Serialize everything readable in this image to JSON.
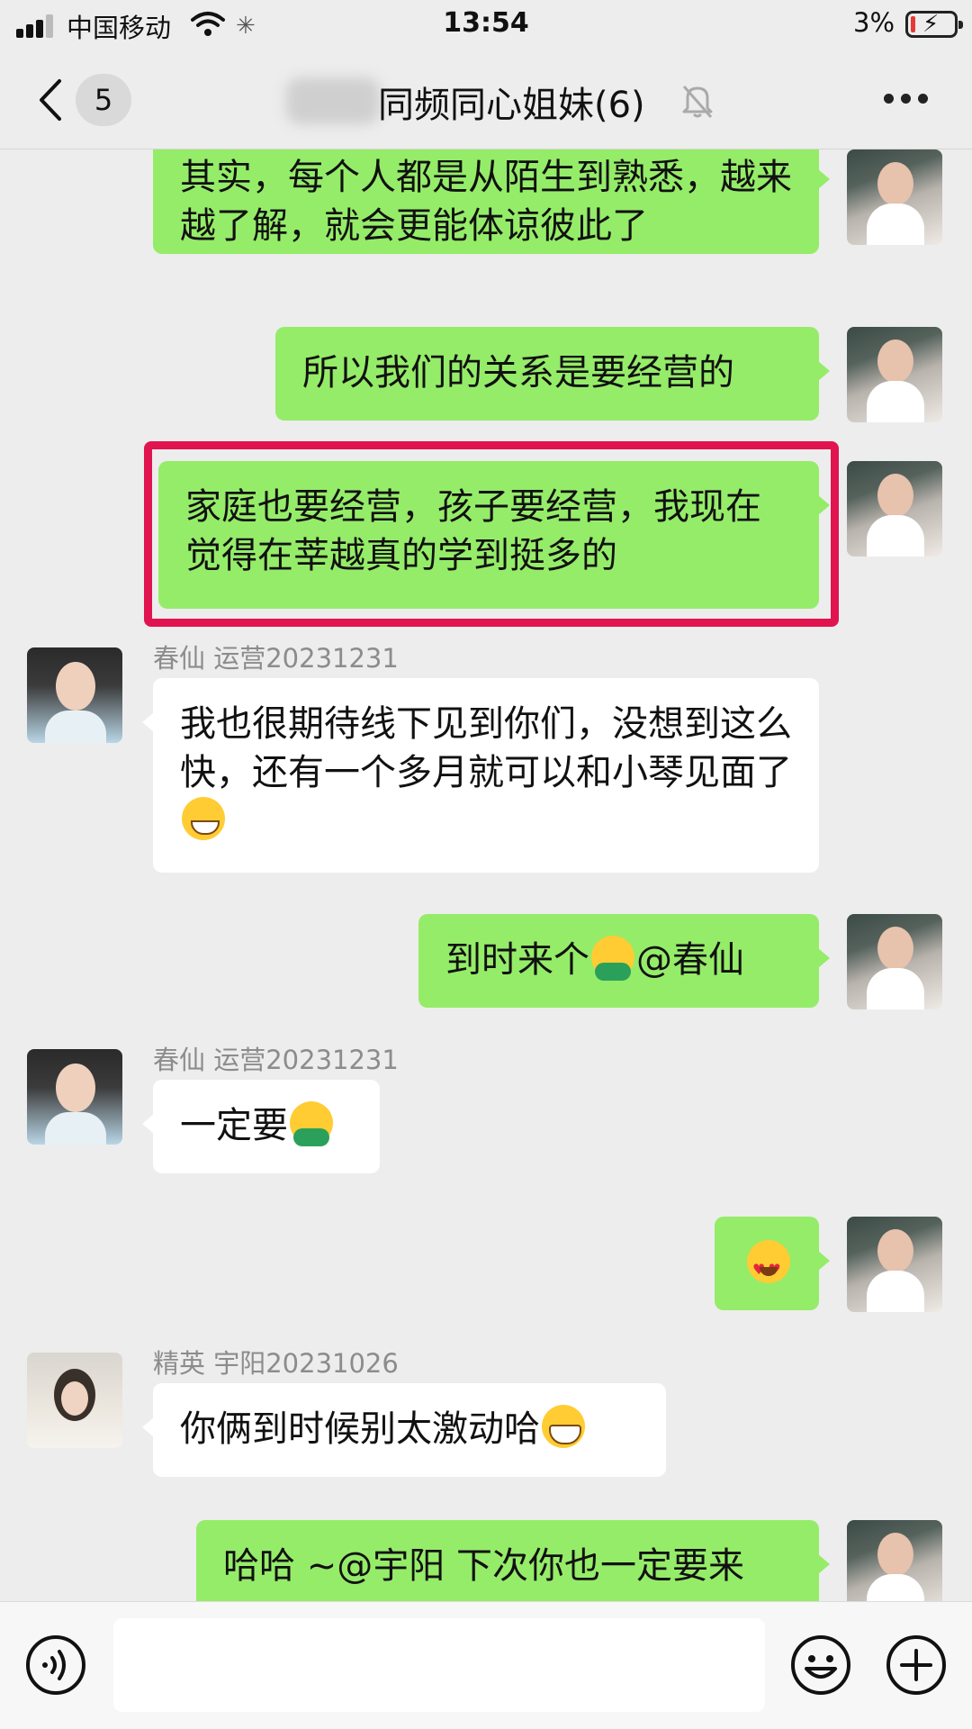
{
  "status_bar": {
    "carrier": "中国移动",
    "time": "13:54",
    "battery": "3%",
    "icons": [
      "signal-icon",
      "wifi-icon",
      "loading-icon",
      "battery-icon"
    ]
  },
  "nav": {
    "unread_count": "5",
    "title": "同频同心姐妹(6)",
    "icons": [
      "back-icon",
      "mute-bell-icon",
      "more-icon"
    ]
  },
  "messages": [
    {
      "from": "me",
      "text": "其实，每个人都是从陌生到熟悉，越来越了解，就会更能体谅彼此了"
    },
    {
      "from": "me",
      "text": "所以我们的关系是要经营的"
    },
    {
      "from": "me",
      "text": "家庭也要经营，孩子要经营，我现在觉得在莘越真的学到挺多的",
      "highlighted": true,
      "highlight_color": "#e0144f"
    },
    {
      "from": "other",
      "sender": "春仙 运营20231231",
      "text": "我也很期待线下见到你们，没想到这么快，还有一个多月就可以和小琴见面了",
      "emoji": "grin-emoji"
    },
    {
      "from": "me",
      "text_before": "到时来个",
      "emoji": "hug-emoji",
      "text_after": "@春仙"
    },
    {
      "from": "other",
      "sender": "春仙 运营20231231",
      "text": "一定要",
      "emoji": "hug-emoji"
    },
    {
      "from": "me",
      "emoji": "heart-eyes-emoji"
    },
    {
      "from": "other",
      "sender": "精英 宇阳20231026",
      "text": "你俩到时候别太激动哈",
      "emoji": "big-grin-emoji"
    },
    {
      "from": "me",
      "text": "哈哈 ~@宇阳 下次你也一定要来"
    }
  ],
  "input_bar": {
    "value": "",
    "icons": [
      "voice-icon",
      "emoji-icon",
      "plus-icon"
    ]
  },
  "colors": {
    "background": "#ededed",
    "my_bubble": "#95ec69",
    "other_bubble": "#ffffff",
    "highlight_border": "#e0144f"
  }
}
